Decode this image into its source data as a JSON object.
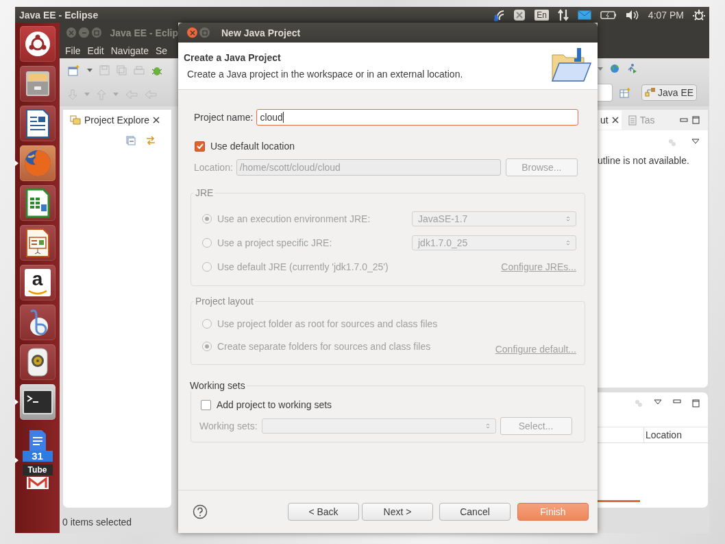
{
  "top_panel": {
    "title": "Java EE - Eclipse",
    "keyboard": "En",
    "clock": "4:07 PM"
  },
  "launcher": [
    {
      "kind": "dash",
      "running": false
    },
    {
      "kind": "files",
      "running": false
    },
    {
      "kind": "writer",
      "running": false
    },
    {
      "kind": "firefox",
      "running": true
    },
    {
      "kind": "calc",
      "running": false
    },
    {
      "kind": "impress",
      "running": false
    },
    {
      "kind": "amazon",
      "running": false,
      "glyph": "a"
    },
    {
      "kind": "player",
      "running": false
    },
    {
      "kind": "speaker",
      "running": false
    },
    {
      "kind": "terminal",
      "running": true
    },
    {
      "kind": "stack",
      "running": true,
      "glyphs": [
        "31",
        "Tube"
      ]
    }
  ],
  "eclipse": {
    "title": "Java EE - Eclip",
    "menu": [
      "File",
      "Edit",
      "Navigate",
      "Se"
    ],
    "perspective": "Java EE",
    "explorer_tab": {
      "label": "Project Explore",
      "selected": true
    },
    "outline_tabs": [
      {
        "label": "ut",
        "selected": true
      },
      {
        "label": "Tas",
        "selected": false
      }
    ],
    "outline_message": "utline is not available.",
    "lower_panel": {
      "columns": [
        "Location"
      ]
    },
    "status_bar": "0 items selected"
  },
  "dialog": {
    "title": "New Java Project",
    "heading": "Create a Java Project",
    "description": "Create a Java project in the workspace or in an external location.",
    "project_name": {
      "label": "Project name:",
      "value": "cloud"
    },
    "use_default_location": {
      "label": "Use default location",
      "checked": true
    },
    "location": {
      "label": "Location:",
      "value": "/home/scott/cloud/cloud",
      "disabled": true,
      "button": "Browse..."
    },
    "jre": {
      "title": "JRE",
      "disabled": true,
      "options": [
        {
          "label": "Use an execution environment JRE:",
          "selected": true,
          "combo": "JavaSE-1.7"
        },
        {
          "label": "Use a project specific JRE:",
          "selected": false,
          "combo": "jdk1.7.0_25"
        },
        {
          "label": "Use default JRE (currently 'jdk1.7.0_25')",
          "selected": false,
          "link": "Configure JREs..."
        }
      ]
    },
    "project_layout": {
      "title": "Project layout",
      "disabled": true,
      "options": [
        {
          "label": "Use project folder as root for sources and class files",
          "selected": false
        },
        {
          "label": "Create separate folders for sources and class files",
          "selected": true,
          "link": "Configure default..."
        }
      ]
    },
    "working_sets": {
      "title": "Working sets",
      "checkbox": {
        "label": "Add project to working sets",
        "checked": false
      },
      "label": "Working sets:",
      "disabled": true,
      "button": "Select..."
    },
    "buttons": [
      {
        "label": "< Back",
        "default": false
      },
      {
        "label": "Next >",
        "default": false
      },
      {
        "label": "Cancel",
        "default": false
      },
      {
        "label": "Finish",
        "default": true
      }
    ]
  }
}
